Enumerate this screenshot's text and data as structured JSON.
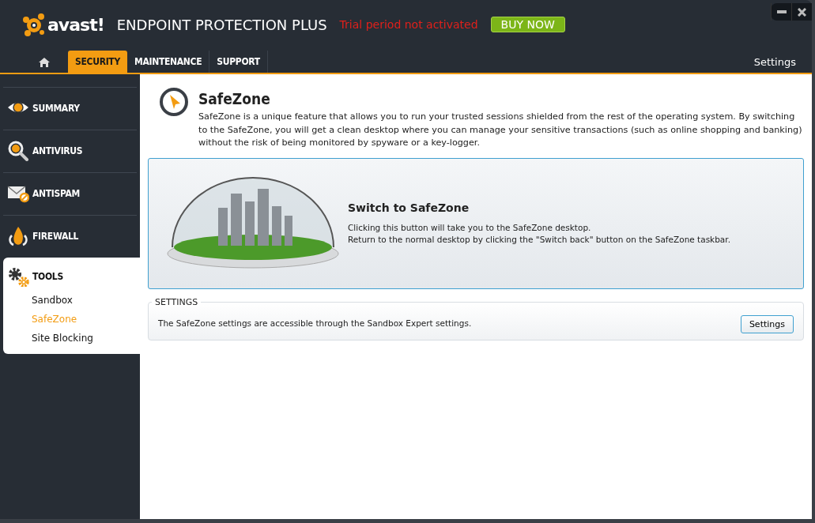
{
  "header": {
    "logo": "avast!",
    "product": "ENDPOINT PROTECTION PLUS",
    "trial_notice": "Trial period not activated",
    "buy_button": "BUY NOW",
    "tabs": [
      {
        "label": "SECURITY",
        "selected": true
      },
      {
        "label": "MAINTENANCE",
        "selected": false
      },
      {
        "label": "SUPPORT",
        "selected": false
      }
    ],
    "settings_link": "Settings"
  },
  "sidebar": {
    "items": [
      {
        "label": "SUMMARY",
        "expanded": false
      },
      {
        "label": "ANTIVIRUS",
        "expanded": false
      },
      {
        "label": "ANTISPAM",
        "expanded": false
      },
      {
        "label": "FIREWALL",
        "expanded": false
      },
      {
        "label": "TOOLS",
        "expanded": true,
        "children": [
          {
            "label": "Sandbox",
            "selected": false
          },
          {
            "label": "SafeZone",
            "selected": true
          },
          {
            "label": "Site Blocking",
            "selected": false
          }
        ]
      }
    ]
  },
  "content": {
    "title": "SafeZone",
    "description": "SafeZone is a unique feature that allows you to run your trusted sessions shielded from the rest of the operating system. By switching to the SafeZone, you will get a clean desktop where you can manage your sensitive transactions (such as online shopping and banking) without the risk of being monitored by spyware or a key-logger.",
    "switch_panel": {
      "title": "Switch to SafeZone",
      "lines": [
        "Clicking this button will take you to the SafeZone desktop.",
        "Return to the normal desktop by clicking the \"Switch back\" button on the SafeZone taskbar."
      ]
    },
    "settings_group": {
      "legend": "SETTINGS",
      "text": "The SafeZone settings are accessible through the Sandbox Expert settings.",
      "button": "Settings"
    }
  }
}
